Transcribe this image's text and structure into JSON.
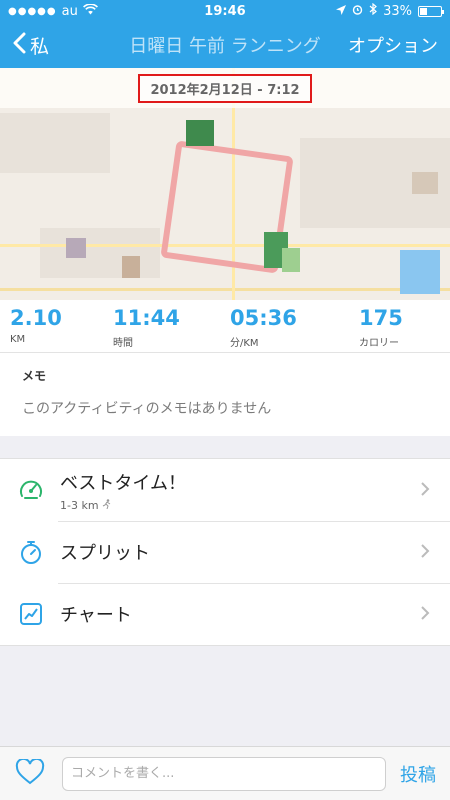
{
  "status_bar": {
    "signal_dots": "●●●●●",
    "carrier": "au",
    "wifi_icon": "wifi-icon",
    "time": "19:46",
    "battery_percent": "33%",
    "battery_level": 0.33
  },
  "nav": {
    "back_label": "私",
    "title": "日曜日 午前 ランニング",
    "option_label": "オプション"
  },
  "map": {
    "date_label": "2012年2月12日 - 7:12"
  },
  "stats": [
    {
      "value": "2.10",
      "label": "KM"
    },
    {
      "value": "11:44",
      "label": "時間"
    },
    {
      "value": "05:36",
      "label": "分/KM"
    },
    {
      "value": "175",
      "label": "カロリー"
    }
  ],
  "memo": {
    "title": "メモ",
    "text": "このアクティビティのメモはありません"
  },
  "menu": [
    {
      "icon": "speedometer-icon",
      "label": "ベストタイム！",
      "sub": "1-3 km"
    },
    {
      "icon": "stopwatch-icon",
      "label": "スプリット",
      "sub": ""
    },
    {
      "icon": "chart-icon",
      "label": "チャート",
      "sub": ""
    }
  ],
  "bottom": {
    "comment_placeholder": "コメントを書く...",
    "post_label": "投稿"
  },
  "colors": {
    "accent": "#2fa4e7",
    "highlight_border": "#e01a1a"
  }
}
